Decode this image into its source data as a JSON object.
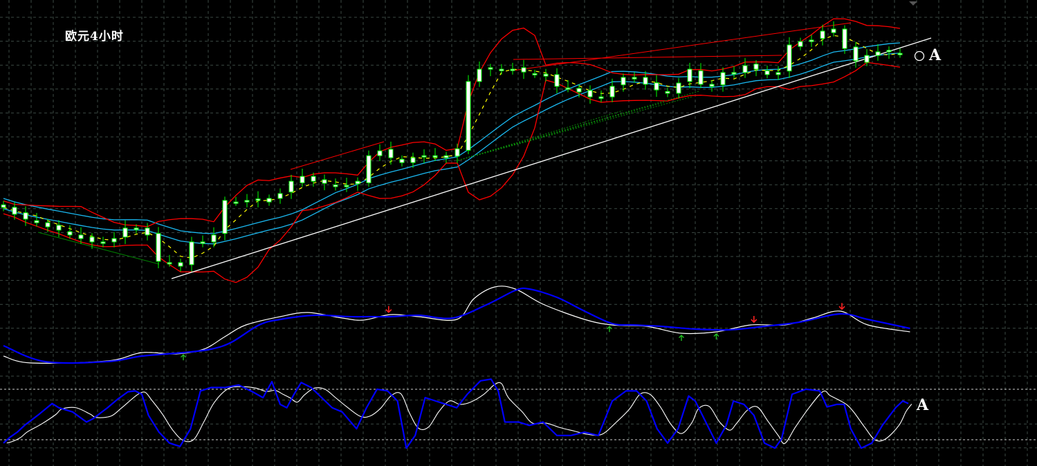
{
  "title": "欧元4小时",
  "marker_label_main": "A",
  "marker_label_stoch": "A",
  "colors": {
    "background": "#000000",
    "grid": "#3c4a44",
    "candle_body": "#ffffff",
    "candle_border": "#00ff00",
    "band_red": "#ff0000",
    "ma_cyan": "#1ab8f0",
    "ma_yellow": "#ffff00",
    "trendline": "#ffffff",
    "down_channel": "#008000",
    "blue_line": "#0000ff",
    "white_line": "#ffffff"
  },
  "chart_data": [
    {
      "type": "candlestick",
      "name": "price",
      "x_unit": "bar",
      "bar_step": 2,
      "closes": [
        25.7,
        23,
        21.1,
        19.7,
        18.1,
        16.8,
        14.9,
        13.5,
        12.2,
        12.2,
        13.5,
        17.6,
        17.6,
        14.9,
        4.6,
        4.1,
        2.7,
        12.2,
        12.2,
        14.9,
        28.4,
        27.8,
        28.4,
        28.4,
        29.2,
        31.1,
        35.9,
        37.8,
        35.9,
        35.1,
        33.8,
        34.3,
        35.9,
        45.9,
        47.8,
        45.1,
        43.2,
        45.1,
        45.9,
        45.9,
        45.1,
        48.6,
        74.9,
        79.7,
        79.7,
        79.7,
        79.7,
        78.6,
        77.8,
        77,
        73,
        72.2,
        70.8,
        68.9,
        68.9,
        73,
        76.5,
        76.5,
        73.8,
        71.6,
        70.3,
        74.3,
        79.7,
        73.8,
        73,
        78.4,
        78.4,
        81.1,
        79.7,
        77.6,
        78.4,
        89.2,
        90.5,
        91.1,
        94.6,
        95.4,
        87.8,
        83,
        85.1,
        86.5,
        86.5,
        85.7
      ],
      "ylim": [
        0,
        100
      ]
    },
    {
      "type": "line",
      "name": "oscillator",
      "ylim": [
        0,
        115
      ],
      "series": [
        {
          "name": "blue",
          "points": [
            [
              0,
              25
            ],
            [
              7.5,
              2
            ],
            [
              18.8,
              2
            ],
            [
              25,
              10
            ],
            [
              32.5,
              15
            ],
            [
              37.5,
              20
            ],
            [
              41.2,
              30
            ],
            [
              46.2,
              55
            ],
            [
              50,
              63
            ],
            [
              56.2,
              69
            ],
            [
              62.5,
              67
            ],
            [
              66.2,
              67
            ],
            [
              70,
              67
            ],
            [
              75,
              69
            ],
            [
              81.2,
              65
            ],
            [
              87.5,
              85
            ],
            [
              92.5,
              105
            ],
            [
              95,
              107
            ],
            [
              100,
              95
            ],
            [
              105,
              75
            ],
            [
              110,
              57
            ],
            [
              113.8,
              55
            ],
            [
              118.8,
              53
            ],
            [
              125,
              49
            ],
            [
              131.2,
              48
            ],
            [
              137.5,
              53
            ],
            [
              143.8,
              59
            ],
            [
              151.2,
              71
            ],
            [
              156.2,
              63
            ],
            [
              163.8,
              50
            ]
          ]
        },
        {
          "name": "white",
          "points": [
            [
              0,
              10
            ],
            [
              5,
              0
            ],
            [
              18.8,
              3
            ],
            [
              25,
              15
            ],
            [
              31.2,
              13
            ],
            [
              36.2,
              20
            ],
            [
              40,
              38
            ],
            [
              43.8,
              55
            ],
            [
              50,
              67
            ],
            [
              55,
              73
            ],
            [
              61.2,
              65
            ],
            [
              65,
              62
            ],
            [
              70,
              70
            ],
            [
              75,
              67
            ],
            [
              81.9,
              63
            ],
            [
              85,
              93
            ],
            [
              88.8,
              110
            ],
            [
              92.5,
              107
            ],
            [
              97.5,
              85
            ],
            [
              105,
              63
            ],
            [
              110,
              55
            ],
            [
              116.2,
              53
            ],
            [
              122.5,
              43
            ],
            [
              128.8,
              45
            ],
            [
              135,
              55
            ],
            [
              141.2,
              55
            ],
            [
              146.2,
              65
            ],
            [
              151.2,
              75
            ],
            [
              156.2,
              55
            ],
            [
              163.8,
              45
            ]
          ]
        }
      ],
      "sell_arrows_bar": [
        69.6,
        135.6,
        151.5
      ],
      "buy_arrows_bar": [
        32.5,
        109.5,
        122.5,
        128.8
      ]
    },
    {
      "type": "line",
      "name": "stochastic",
      "ylim": [
        0,
        100
      ],
      "levels": [
        20,
        80
      ],
      "series": [
        {
          "name": "blue",
          "points": [
            [
              0,
              16
            ],
            [
              1.2,
              23
            ],
            [
              2.5,
              29
            ],
            [
              3.8,
              37
            ],
            [
              6.2,
              49
            ],
            [
              8.8,
              63
            ],
            [
              10,
              58
            ],
            [
              12.5,
              53
            ],
            [
              15,
              41
            ],
            [
              16.2,
              45
            ],
            [
              18.8,
              58
            ],
            [
              20.6,
              68
            ],
            [
              22.5,
              77
            ],
            [
              23.8,
              78
            ],
            [
              25,
              74
            ],
            [
              26.2,
              49
            ],
            [
              28.1,
              29
            ],
            [
              30,
              16
            ],
            [
              31.9,
              12
            ],
            [
              33.8,
              33
            ],
            [
              35.6,
              78
            ],
            [
              37.5,
              82
            ],
            [
              40,
              82
            ],
            [
              42.5,
              85
            ],
            [
              45,
              77
            ],
            [
              46.9,
              70
            ],
            [
              48.5,
              89
            ],
            [
              50,
              62
            ],
            [
              51.2,
              58
            ],
            [
              52.5,
              74
            ],
            [
              53.8,
              88
            ],
            [
              55.6,
              82
            ],
            [
              57.5,
              70
            ],
            [
              59.4,
              58
            ],
            [
              61.2,
              53
            ],
            [
              63.8,
              33
            ],
            [
              65.6,
              58
            ],
            [
              67.5,
              80
            ],
            [
              69.4,
              78
            ],
            [
              71.2,
              66
            ],
            [
              72.8,
              10
            ],
            [
              74.4,
              25
            ],
            [
              76.2,
              70
            ],
            [
              78.1,
              66
            ],
            [
              80,
              62
            ],
            [
              81.9,
              58
            ],
            [
              83.8,
              74
            ],
            [
              86.2,
              90
            ],
            [
              88.1,
              92
            ],
            [
              89.4,
              78
            ],
            [
              90.6,
              41
            ],
            [
              93.1,
              41
            ],
            [
              95,
              37
            ],
            [
              97.5,
              41
            ],
            [
              100,
              25
            ],
            [
              102.5,
              25
            ],
            [
              105,
              29
            ],
            [
              107.5,
              25
            ],
            [
              110,
              66
            ],
            [
              112.5,
              78
            ],
            [
              114.4,
              78
            ],
            [
              116.2,
              66
            ],
            [
              118.1,
              33
            ],
            [
              120,
              16
            ],
            [
              121.9,
              33
            ],
            [
              123.8,
              72
            ],
            [
              125,
              66
            ],
            [
              126.9,
              41
            ],
            [
              128.8,
              16
            ],
            [
              130.6,
              37
            ],
            [
              131.9,
              66
            ],
            [
              133.8,
              62
            ],
            [
              135.6,
              49
            ],
            [
              137.5,
              16
            ],
            [
              139.4,
              10
            ],
            [
              140.6,
              21
            ],
            [
              142.5,
              74
            ],
            [
              145,
              80
            ],
            [
              147.5,
              78
            ],
            [
              148.8,
              59
            ],
            [
              150.6,
              62
            ],
            [
              151.9,
              62
            ],
            [
              153.1,
              33
            ],
            [
              155,
              10
            ],
            [
              156.9,
              16
            ],
            [
              158.8,
              37
            ],
            [
              161.2,
              58
            ],
            [
              162.5,
              66
            ],
            [
              163.5,
              63
            ]
          ]
        }
      ]
    }
  ]
}
